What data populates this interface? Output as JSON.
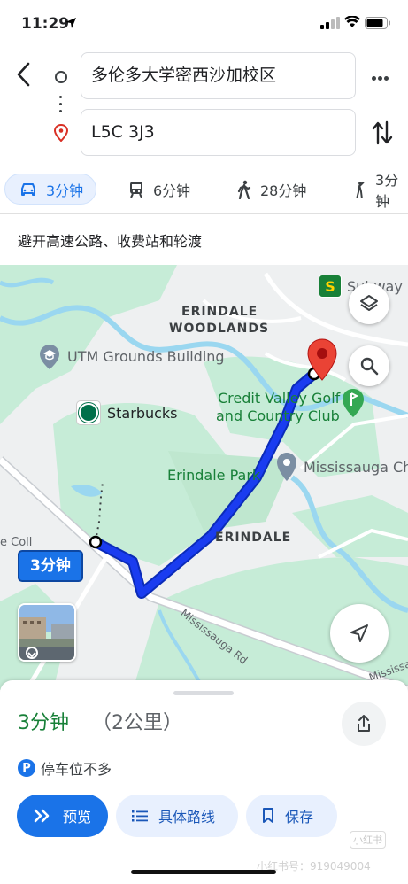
{
  "status": {
    "time": "11:29"
  },
  "route": {
    "origin": "多伦多大学密西沙加校区",
    "destination": "L5C 3J3"
  },
  "modes": [
    {
      "name": "drive",
      "label": "3分钟"
    },
    {
      "name": "transit",
      "label": "6分钟"
    },
    {
      "name": "walk",
      "label": "28分钟"
    },
    {
      "name": "rideshare",
      "label": "3分钟"
    }
  ],
  "avoid_text": "避开高速公路、收费站和轮渡",
  "map": {
    "labels": {
      "subway": "Subway",
      "erindale_woodlands_1": "ERINDALE",
      "erindale_woodlands_2": "WOODLANDS",
      "utm_grounds": "UTM Grounds Building",
      "starbucks": "Starbucks",
      "credit_valley_1": "Credit Valley Golf",
      "credit_valley_2": "and Country Club",
      "erindale_park": "Erindale Park",
      "mississauga_ch": "Mississauga Ch",
      "erindale": "ERINDALE",
      "mississauga_rd": "Mississauga Rd",
      "mississauga_rd_2": "Mississauga",
      "e_coll": "e Coll"
    },
    "eta_tag": "3分钟",
    "route_color": "#1a3cf0",
    "pin_color": "#ea4335"
  },
  "sheet": {
    "eta": "3分钟",
    "distance": "（2公里）",
    "parking": "停车位不多",
    "parking_badge": "P",
    "buttons": {
      "preview": "预览",
      "steps": "具体路线",
      "save": "保存"
    },
    "watermark": "小红书号：919049004",
    "wm_logo": "小红书"
  }
}
